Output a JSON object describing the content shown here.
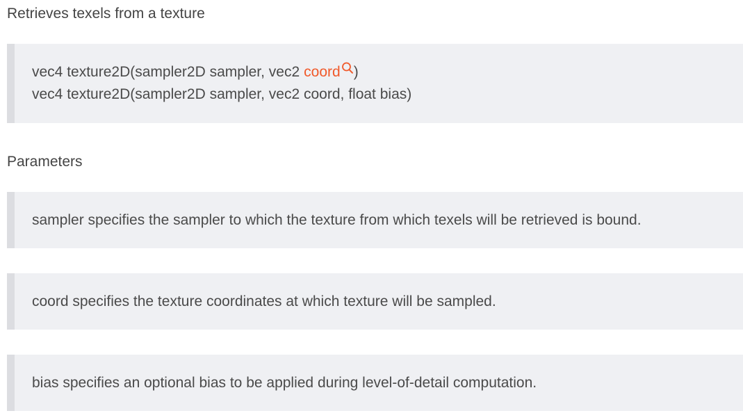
{
  "intro": "Retrieves texels from a texture",
  "signatures": {
    "line1": {
      "prefix": "vec4 texture2D(sampler2D sampler, vec2",
      "link": "coord",
      "suffix": ")"
    },
    "line2": "vec4 texture2D(sampler2D sampler, vec2 coord, float bias)"
  },
  "parameters_heading": "Parameters",
  "parameters": [
    "sampler specifies the sampler to which the texture from which texels will be retrieved is bound.",
    "coord specifies the texture coordinates at which texture will be sampled.",
    "bias specifies an optional bias to be applied during level-of-detail computation."
  ],
  "colors": {
    "link": "#f05a2b",
    "block_background": "#eff0f3",
    "block_border": "#dcdde1",
    "text": "#4a4a4a"
  },
  "icons": {
    "link_icon": "search-icon"
  }
}
